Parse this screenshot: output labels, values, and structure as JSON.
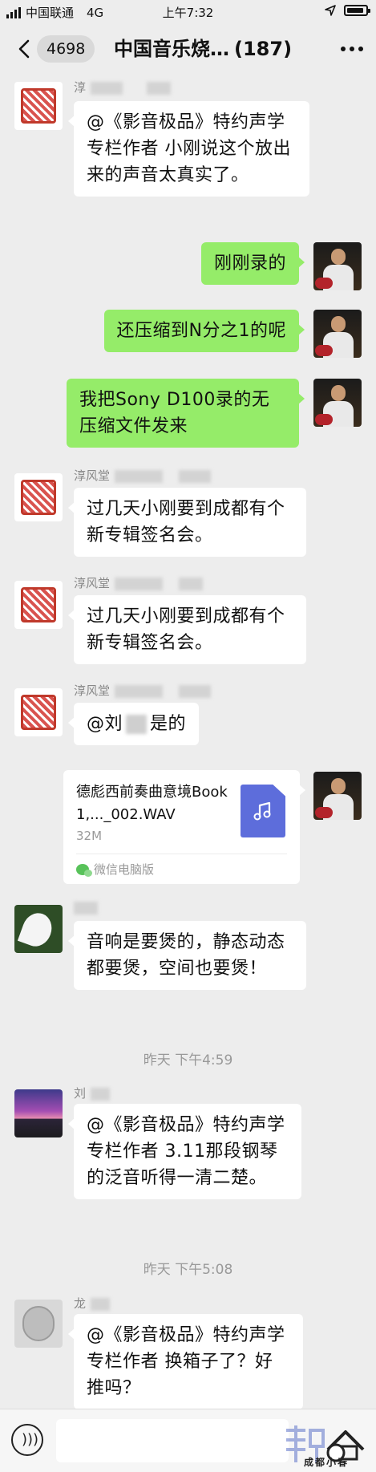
{
  "status": {
    "carrier": "中国联通",
    "network": "4G",
    "time": "上午7:32"
  },
  "nav": {
    "unread": "4698",
    "title": "中国音乐烧…",
    "count": "(187)"
  },
  "messages": [
    {
      "name": "淳",
      "text": "@《影音极品》特约声学专栏作者 小刚说这个放出来的声音太真实了。"
    },
    {
      "text": "刚刚录的"
    },
    {
      "text": "还压缩到N分之1的呢"
    },
    {
      "text": "我把Sony D100录的无压缩文件发来"
    },
    {
      "name": "淳风堂",
      "text": "过几天小刚要到成都有个新专辑签名会。"
    },
    {
      "name": "淳风堂",
      "text": "过几天小刚要到成都有个新专辑签名会。"
    },
    {
      "name": "淳风堂",
      "text_a": "@刘",
      "text_b": "是的"
    },
    {
      "text": "音响是要煲的，静态动态都要煲，空间也要煲！"
    },
    {
      "name": "刘",
      "text": "@《影音极品》特约声学专栏作者 3.11那段钢琴的泛音听得一清二楚。"
    },
    {
      "name": "龙",
      "text": "@《影音极品》特约声学专栏作者 换箱子了？好推吗？"
    }
  ],
  "file": {
    "name": "德彪西前奏曲意境Book 1,..._002.WAV",
    "size": "32M",
    "source": "微信电脑版"
  },
  "timestamps": [
    "昨天 下午4:59",
    "昨天 下午5:08"
  ],
  "watermark": {
    "text": "成都小春"
  },
  "icons": {
    "signal": "signal-bars-icon",
    "battery": "battery-icon",
    "location": "location-arrow-icon",
    "back": "chevron-left-icon",
    "more": "more-dots-icon",
    "voice": "voice-input-icon",
    "music": "music-note-icon",
    "wechat": "wechat-icon"
  }
}
